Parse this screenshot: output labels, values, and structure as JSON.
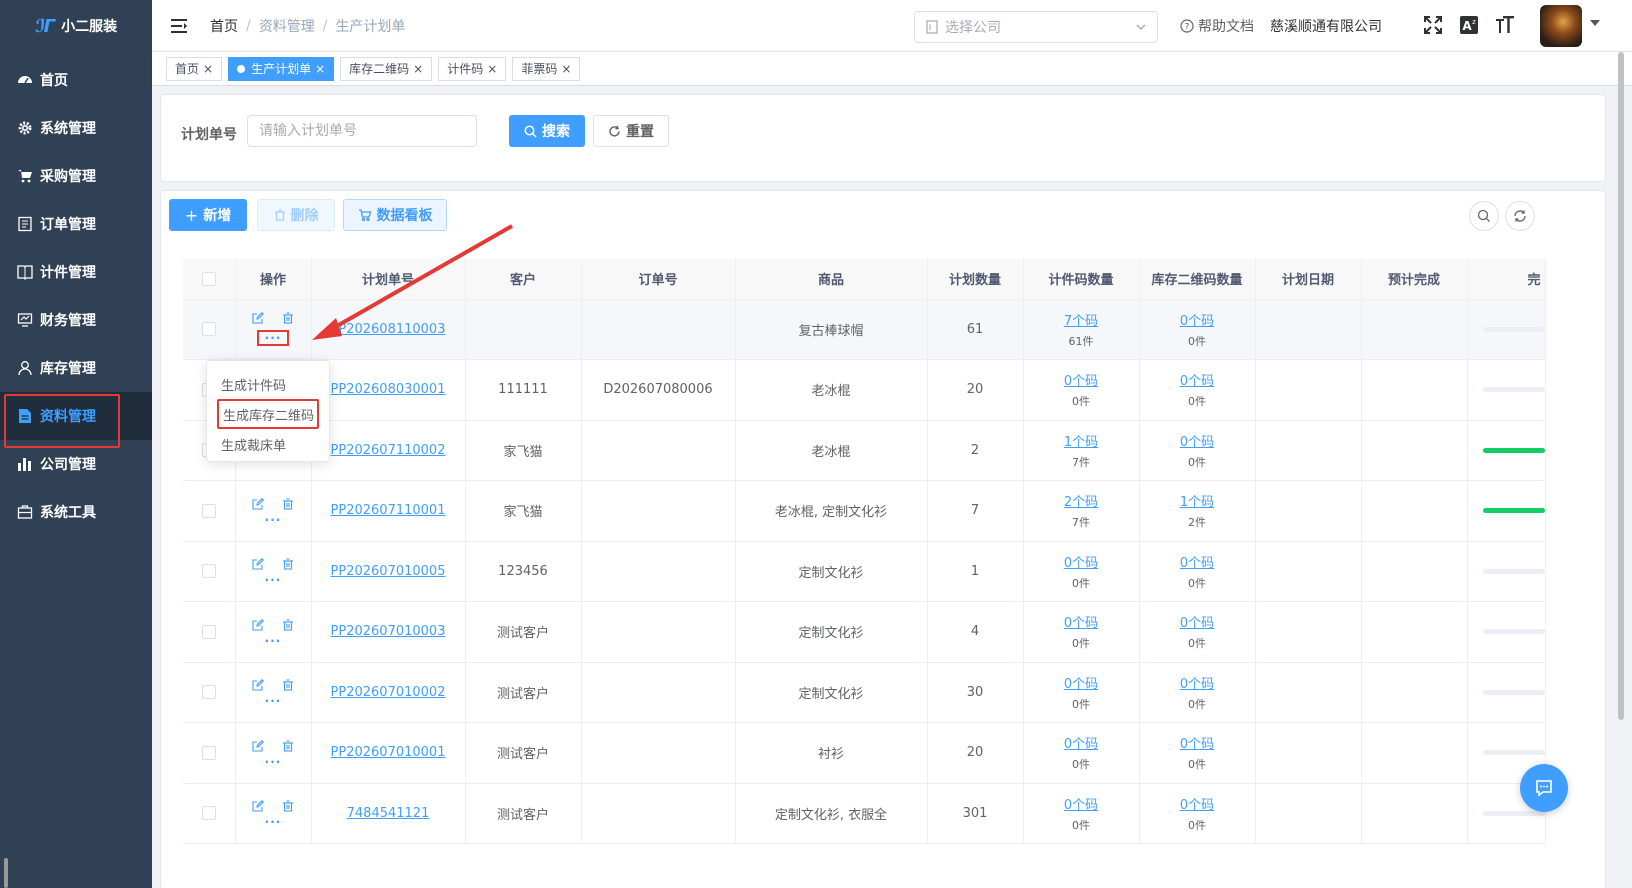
{
  "app": {
    "name": "小二服装"
  },
  "sidebar": {
    "items": [
      {
        "label": "首页",
        "icon": "dashboard-icon"
      },
      {
        "label": "系统管理",
        "icon": "gear-icon"
      },
      {
        "label": "采购管理",
        "icon": "cart-icon"
      },
      {
        "label": "订单管理",
        "icon": "order-icon"
      },
      {
        "label": "计件管理",
        "icon": "book-icon"
      },
      {
        "label": "财务管理",
        "icon": "finance-icon"
      },
      {
        "label": "库存管理",
        "icon": "user-icon"
      },
      {
        "label": "资料管理",
        "icon": "document-icon",
        "active": true
      },
      {
        "label": "公司管理",
        "icon": "bar-chart-icon"
      },
      {
        "label": "系统工具",
        "icon": "toolbox-icon"
      }
    ]
  },
  "header": {
    "breadcrumb": [
      "首页",
      "资料管理",
      "生产计划单"
    ],
    "breadcrumb_sep": "/",
    "company_placeholder": "选择公司",
    "help_label": "帮助文档",
    "company_name": "慈溪顺通有限公司"
  },
  "tags": [
    {
      "label": "首页",
      "active": false
    },
    {
      "label": "生产计划单",
      "active": true
    },
    {
      "label": "库存二维码",
      "active": false
    },
    {
      "label": "计件码",
      "active": false
    },
    {
      "label": "菲票码",
      "active": false
    }
  ],
  "search": {
    "label": "计划单号",
    "placeholder": "请输入计划单号",
    "search_btn": "搜索",
    "reset_btn": "重置"
  },
  "toolbar": {
    "add": "新增",
    "delete": "删除",
    "board": "数据看板"
  },
  "table": {
    "columns": [
      "操作",
      "计划单号",
      "客户",
      "订单号",
      "商品",
      "计划数量",
      "计件码数量",
      "库存二维码数量",
      "计划日期",
      "预计完成",
      "完"
    ],
    "rows": [
      {
        "plan_no": "PP202608110003",
        "customer": "",
        "order_no": "",
        "product": "复古棒球帽",
        "qty": "61",
        "piece_codes": "7个码",
        "piece_count": "61件",
        "stock_codes": "0个码",
        "stock_count": "0件",
        "progress": 0
      },
      {
        "plan_no": "PP202608030001",
        "customer": "111111",
        "order_no": "D202607080006",
        "product": "老冰棍",
        "qty": "20",
        "piece_codes": "0个码",
        "piece_count": "0件",
        "stock_codes": "0个码",
        "stock_count": "0件",
        "progress": 0
      },
      {
        "plan_no": "PP202607110002",
        "customer": "家飞猫",
        "order_no": "",
        "product": "老冰棍",
        "qty": "2",
        "piece_codes": "1个码",
        "piece_count": "7件",
        "stock_codes": "0个码",
        "stock_count": "0件",
        "progress": 1
      },
      {
        "plan_no": "PP202607110001",
        "customer": "家飞猫",
        "order_no": "",
        "product": "老冰棍, 定制文化衫",
        "qty": "7",
        "piece_codes": "2个码",
        "piece_count": "7件",
        "stock_codes": "1个码",
        "stock_count": "2件",
        "progress": 1
      },
      {
        "plan_no": "PP202607010005",
        "customer": "123456",
        "order_no": "",
        "product": "定制文化衫",
        "qty": "1",
        "piece_codes": "0个码",
        "piece_count": "0件",
        "stock_codes": "0个码",
        "stock_count": "0件",
        "progress": 0
      },
      {
        "plan_no": "PP202607010003",
        "customer": "测试客户",
        "order_no": "",
        "product": "定制文化衫",
        "qty": "4",
        "piece_codes": "0个码",
        "piece_count": "0件",
        "stock_codes": "0个码",
        "stock_count": "0件",
        "progress": 0
      },
      {
        "plan_no": "PP202607010002",
        "customer": "测试客户",
        "order_no": "",
        "product": "定制文化衫",
        "qty": "30",
        "piece_codes": "0个码",
        "piece_count": "0件",
        "stock_codes": "0个码",
        "stock_count": "0件",
        "progress": 0
      },
      {
        "plan_no": "PP202607010001",
        "customer": "测试客户",
        "order_no": "",
        "product": "衬衫",
        "qty": "20",
        "piece_codes": "0个码",
        "piece_count": "0件",
        "stock_codes": "0个码",
        "stock_count": "0件",
        "progress": 0
      },
      {
        "plan_no": "7484541121",
        "customer": "测试客户",
        "order_no": "",
        "product": "定制文化衫, 衣服全",
        "qty": "301",
        "piece_codes": "0个码",
        "piece_count": "0件",
        "stock_codes": "0个码",
        "stock_count": "0件",
        "progress": 0
      }
    ]
  },
  "dropdown": {
    "items": [
      "生成计件码",
      "生成库存二维码",
      "生成裁床单"
    ]
  },
  "colors": {
    "sidebar_bg": "#304156",
    "primary": "#409eff",
    "highlight": "#e53935",
    "progress": "#13ce66"
  }
}
